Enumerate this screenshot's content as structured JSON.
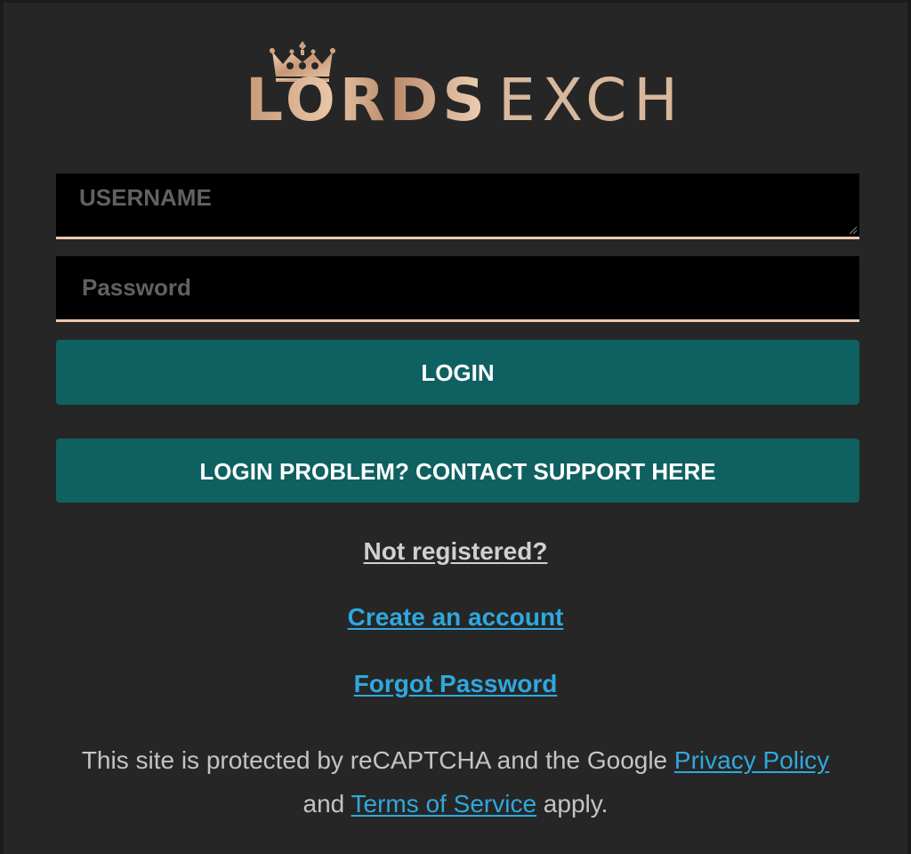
{
  "brand": {
    "name_bold": "LORDS",
    "name_light": "EXCH",
    "logo_icon": "crown-icon",
    "gold_color": "#d8b89c"
  },
  "login_form": {
    "username_placeholder": "USERNAME",
    "password_placeholder": "Password",
    "login_label": "LOGIN",
    "support_label": "LOGIN PROBLEM? CONTACT SUPPORT HERE"
  },
  "links": {
    "not_registered": "Not registered?",
    "create_account": "Create an account",
    "forgot_password": "Forgot Password"
  },
  "recaptcha": {
    "text_before": "This site is protected by reCAPTCHA and the Google ",
    "privacy_link": "Privacy Policy",
    "text_middle": " and ",
    "terms_link": "Terms of Service",
    "text_after": " apply."
  },
  "colors": {
    "background": "#262626",
    "button": "#0f6060",
    "input_underline": "#f0c7b0",
    "link": "#2fa8de"
  }
}
